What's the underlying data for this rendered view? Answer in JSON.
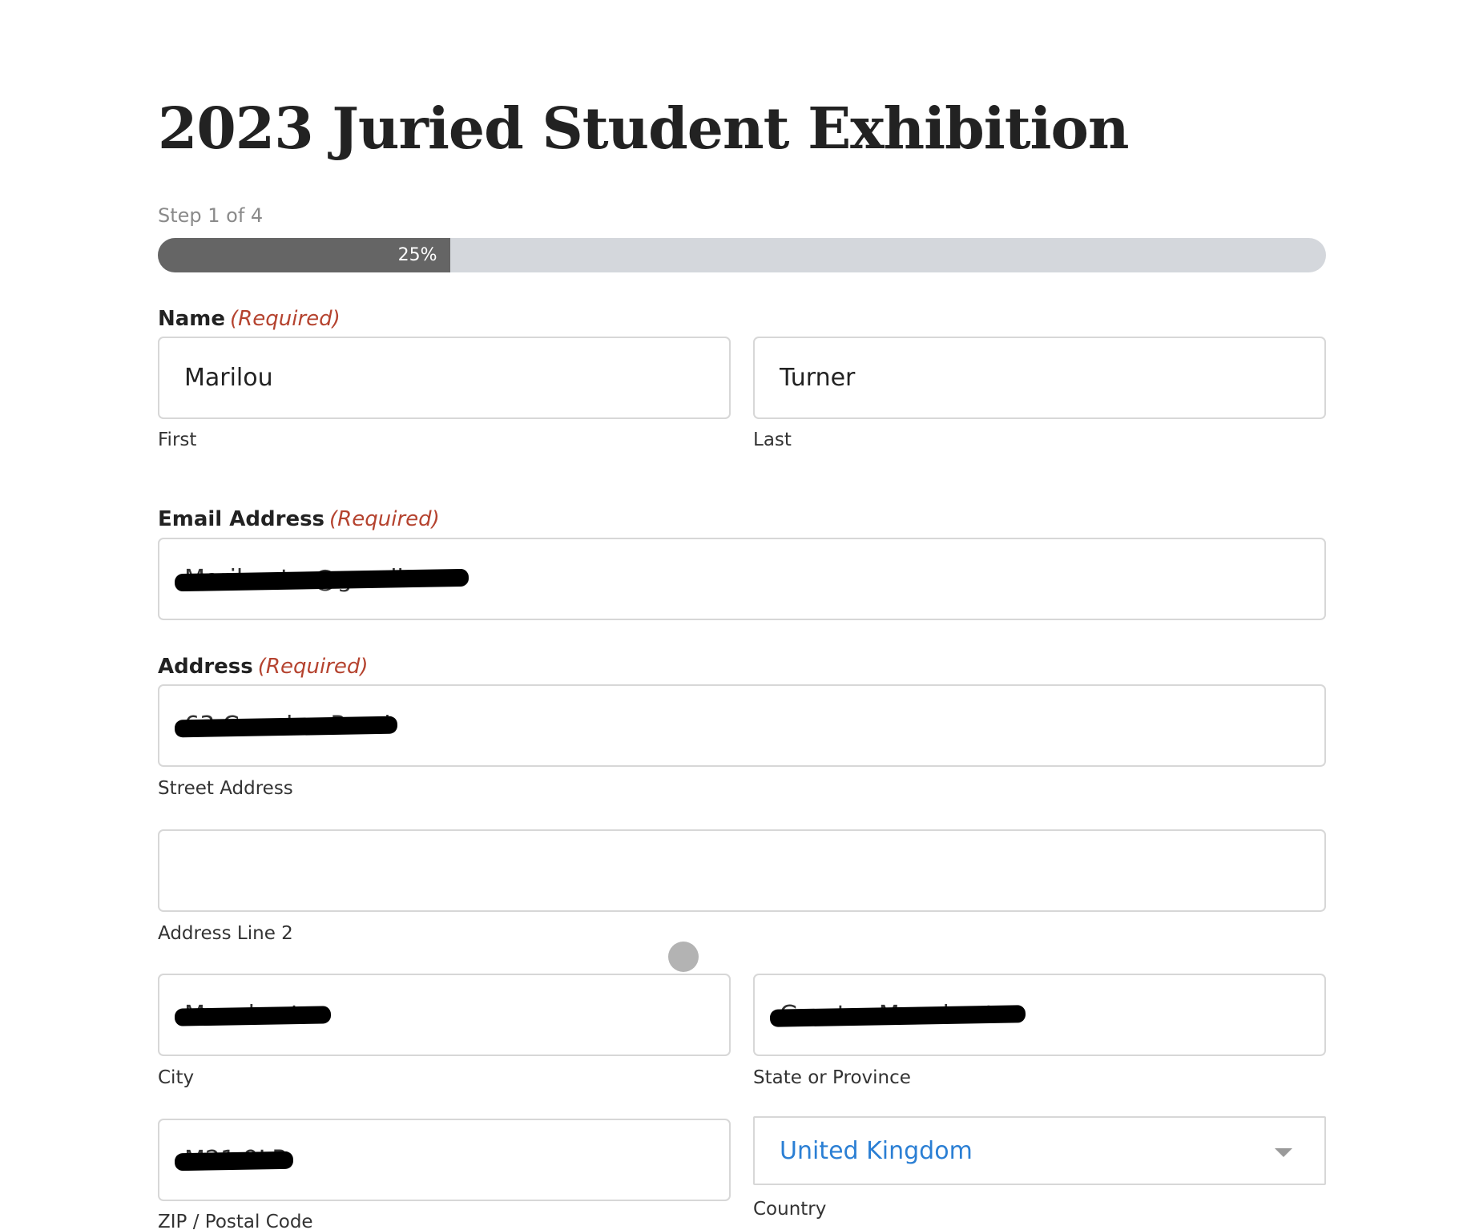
{
  "form": {
    "title": "2023 Juried Student Exhibition",
    "step_label": "Step 1 of 4",
    "progress": {
      "percent": 25,
      "label": "25%"
    },
    "required_text": "(Required)",
    "name": {
      "label": "Name",
      "first": {
        "value": "Marilou",
        "sublabel": "First"
      },
      "last": {
        "value": "Turner",
        "sublabel": "Last"
      }
    },
    "email": {
      "label": "Email Address",
      "value": "Marilou.t...@gmail.com",
      "redacted": true
    },
    "address": {
      "label": "Address",
      "street": {
        "value": "63 Camden Road",
        "sublabel": "Street Address",
        "redacted": true
      },
      "line2": {
        "value": "",
        "sublabel": "Address Line 2"
      },
      "city": {
        "value": "Manchester",
        "sublabel": "City",
        "redacted": true
      },
      "state": {
        "value": "Greater Manchester",
        "sublabel": "State or Province",
        "redacted": true
      },
      "zip": {
        "value": "M21 9LP",
        "sublabel": "ZIP / Postal Code",
        "redacted": true
      },
      "country": {
        "value": "United Kingdom",
        "sublabel": "Country"
      }
    }
  },
  "colors": {
    "required": "#b5432f",
    "progress_fill": "#656565",
    "progress_track": "#d4d7dc",
    "select_text": "#2b7fd4"
  },
  "icons": {
    "dropdown": "chevron-down-icon",
    "cursor": "touch-cursor-indicator"
  }
}
